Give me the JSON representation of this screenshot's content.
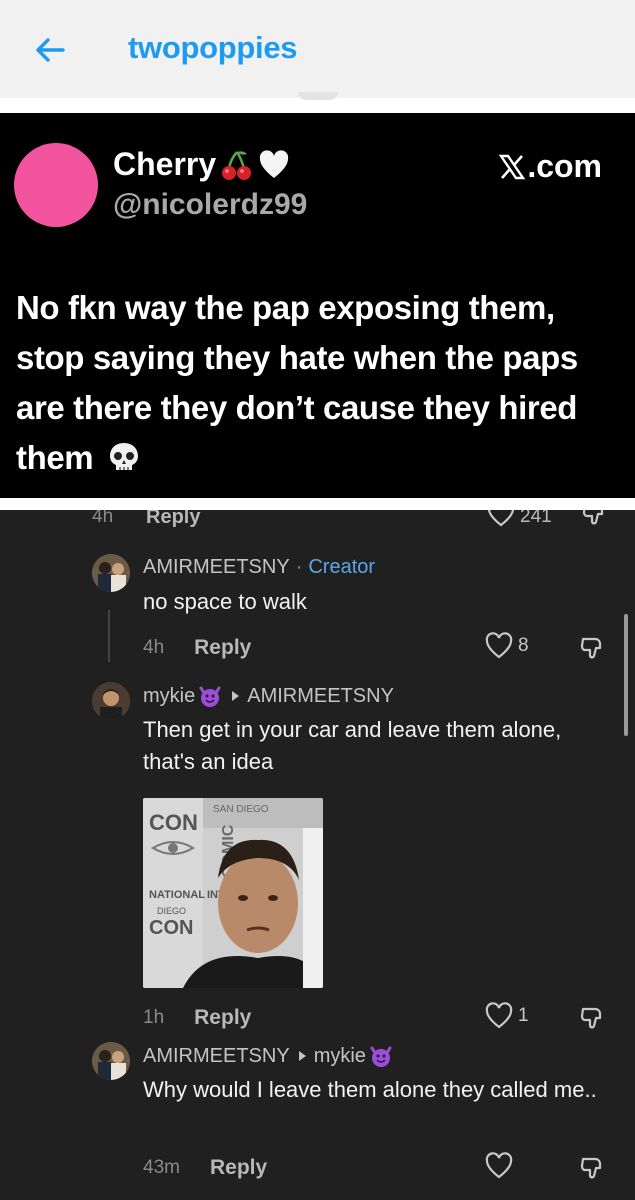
{
  "topbar": {
    "title": "twopoppies",
    "back_icon": "arrow-left-icon",
    "accent": "#1d9bf0"
  },
  "tweet": {
    "name": "Cherry",
    "name_emojis": [
      "cherry-icon",
      "white-heart-icon"
    ],
    "handle": "@nicolerdz99",
    "site": ".com",
    "text": "No fkn way the pap exposing them, stop saying they hate when the paps are there they don’t cause they hired them",
    "text_emoji": "skull-icon",
    "avatar_color": "#f2559e"
  },
  "comments": {
    "previous": {
      "time": "4h",
      "reply_label": "Reply",
      "likes": "241"
    },
    "items": [
      {
        "user": "AMIRMEETSNY",
        "separator": "·",
        "badge": "Creator",
        "text": "no space to walk",
        "time": "4h",
        "reply_label": "Reply",
        "likes": "8"
      },
      {
        "user": "mykie",
        "user_emoji": "smiling-devil-icon",
        "reply_to": "AMIRMEETSNY",
        "text": "Then get in your car and leave them alone, that's an idea",
        "time": "1h",
        "reply_label": "Reply",
        "likes": "1",
        "gif": {
          "labels": [
            "CON",
            "COMIC",
            "NATIONAL",
            "INTE",
            "DIEGO",
            "SAN DIEGO"
          ]
        }
      },
      {
        "user": "AMIRMEETSNY",
        "reply_to": "mykie",
        "reply_to_emoji": "smiling-devil-icon",
        "text": "Why would I leave them alone they called me..",
        "time": "43m",
        "reply_label": "Reply",
        "likes": ""
      }
    ]
  }
}
